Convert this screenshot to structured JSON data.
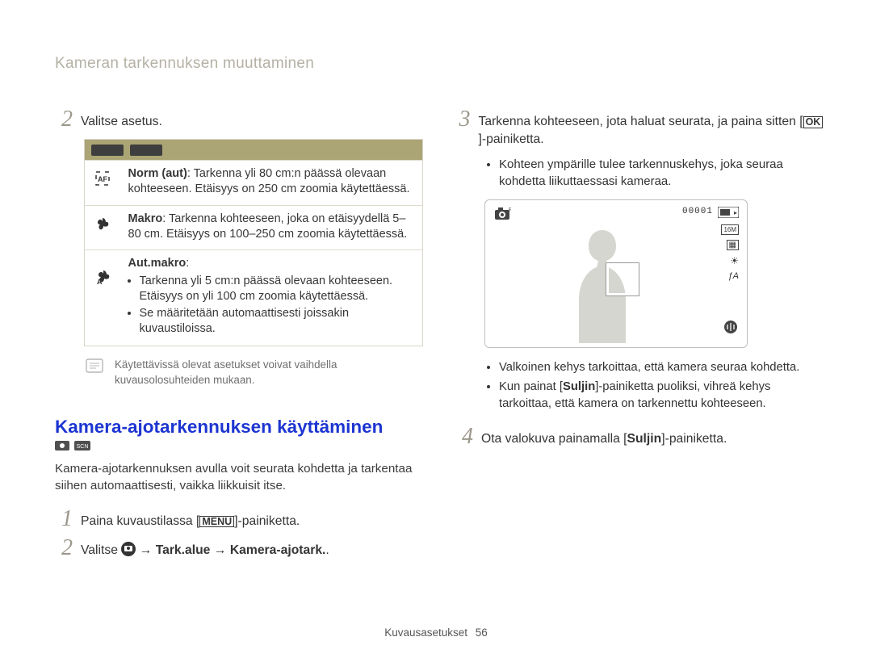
{
  "title": "Kameran tarkennuksen muuttaminen",
  "left": {
    "step2": {
      "text": "Valitse asetus."
    },
    "table": {
      "rows": [
        {
          "title": "Norm (aut)",
          "body": ": Tarkenna yli 80 cm:n päässä olevaan kohteeseen. Etäisyys on 250 cm zoomia käytettäessä.",
          "icon": "af"
        },
        {
          "title": "Makro",
          "body": ": Tarkenna kohteeseen, joka on etäisyydellä 5–80 cm. Etäisyys on 100–250 cm zoomia käytettäessä.",
          "icon": "flower"
        },
        {
          "title": "Aut.makro",
          "body": ":",
          "bullets": [
            "Tarkenna yli 5 cm:n päässä olevaan kohteeseen. Etäisyys on yli 100 cm zoomia käytettäessä.",
            "Se määritetään automaattisesti joissakin kuvaustiloissa."
          ],
          "icon": "flower-a"
        }
      ]
    },
    "note": "Käytettävissä olevat asetukset voivat vaihdella kuvausolosuhteiden mukaan.",
    "section_title": "Kamera-ajotarkennuksen käyttäminen",
    "intro": "Kamera-ajotarkennuksen avulla voit seurata kohdetta ja tarkentaa siihen automaattisesti, vaikka liikkuisit itse.",
    "s1_a": "Paina kuvaustilassa [",
    "s1_b": "]-painiketta.",
    "menu_label": "MENU",
    "s2_a": "Valitse ",
    "s2_b": " → ",
    "s2_bold1": "Tark.alue",
    "s2_c": " → ",
    "s2_bold2": "Kamera-ajotark.",
    "s2_d": "."
  },
  "right": {
    "s3_a": "Tarkenna kohteeseen, jota haluat seurata, ja paina sitten [",
    "ok_label": "OK",
    "s3_b": "]-painiketta.",
    "s3_bullet": "Kohteen ympärille tulee tarkennuskehys, joka seuraa kohdetta liikuttaessasi kameraa.",
    "counter": "00001",
    "side": {
      "a": "16M",
      "b": "▦",
      "c": "☀",
      "d": "ƒA"
    },
    "after_b1": "Valkoinen kehys tarkoittaa, että kamera seuraa kohdetta.",
    "after_b2_a": "Kun painat [",
    "after_b2_bold": "Suljin",
    "after_b2_b": "]-painiketta puoliksi, vihreä kehys tarkoittaa, että kamera on tarkennettu kohteeseen.",
    "s4_a": "Ota valokuva painamalla [",
    "s4_bold": "Suljin",
    "s4_b": "]-painiketta."
  },
  "footer": {
    "section": "Kuvausasetukset",
    "page": "56"
  }
}
